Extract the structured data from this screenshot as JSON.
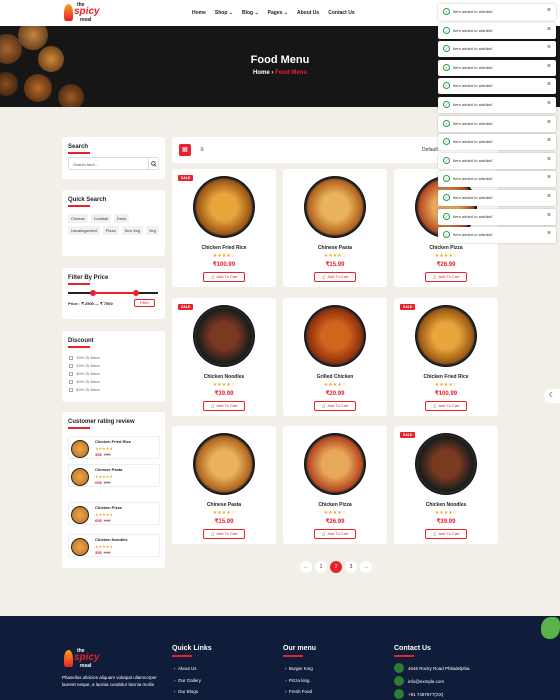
{
  "header": {
    "logo": {
      "top": "the",
      "main": "spicy",
      "bottom": "meal"
    },
    "nav": [
      "Home",
      "Shop ⌄",
      "Blog ⌄",
      "Pages ⌄",
      "About Us",
      "Contact Us"
    ]
  },
  "hero": {
    "title": "Food Menu",
    "crumb_home": "Home",
    "crumb_sep": "›",
    "crumb_current": "Food Menu"
  },
  "sidebar": {
    "search": {
      "title": "Search",
      "placeholder": "Search here..."
    },
    "quick": {
      "title": "Quick Search",
      "tags": [
        "Cheese",
        "Cocktail",
        "Drink",
        "Uncategorized",
        "Pizza",
        "Non Veg",
        "Veg"
      ]
    },
    "price": {
      "title": "Filter By Price",
      "label": "Price : ₹ 2500 — ₹ 7500",
      "button": "Filter",
      "range_low_fraction": 0.25,
      "range_high_fraction": 0.75
    },
    "discount": {
      "title": "Discount",
      "options": [
        "10% Or More",
        "20% Or More",
        "30% Or More",
        "40% Or More",
        "50% Or More"
      ]
    },
    "reviews": {
      "title": "Customer rating review",
      "items": [
        {
          "name": "Chicken Fried Rice",
          "stars": "★★★★★",
          "price": "35$",
          "old": "23$"
        },
        {
          "name": "Chinese Pasta",
          "stars": "★★★★★",
          "price": "65$",
          "old": "25$"
        },
        {
          "name": "Chicken Pizza",
          "stars": "★★★★★",
          "price": "65$",
          "old": "25$"
        },
        {
          "name": "Chicken Noodles",
          "stars": "★★★★★",
          "price": "35$",
          "old": "23$"
        }
      ]
    }
  },
  "toolbar": {
    "grid_icon": "▦",
    "list_icon": "≡",
    "sort_label": "Default"
  },
  "products": [
    {
      "name": "Chicken Fried Rice",
      "price": "₹100.99",
      "sale": "SALE",
      "stars": "★★★★☆",
      "cart": "Add To Cart",
      "color1": "#e7a53c",
      "color2": "#9a5512"
    },
    {
      "name": "Chinese Pasta",
      "price": "₹15.99",
      "sale": "",
      "stars": "★★★★☆",
      "cart": "Add To Cart",
      "color1": "#eab45c",
      "color2": "#b0601d"
    },
    {
      "name": "Chicken Pizza",
      "price": "₹26.99",
      "sale": "",
      "stars": "★★★★☆",
      "cart": "Add To Cart",
      "color1": "#e8a85a",
      "color2": "#b3461f"
    },
    {
      "name": "Chicken Noodles",
      "price": "₹39.99",
      "sale": "SALE",
      "stars": "★★★★☆",
      "cart": "Add To Cart",
      "color1": "#7a3a22",
      "color2": "#1c1c1c"
    },
    {
      "name": "Grilled Chicken",
      "price": "₹20.99",
      "sale": "",
      "stars": "★★★★☆",
      "cart": "Add To Cart",
      "color1": "#d2651e",
      "color2": "#8a2f0c"
    },
    {
      "name": "Chicken Fried Rice",
      "price": "₹100.99",
      "sale": "SALE",
      "stars": "★★★★☆",
      "cart": "Add To Cart",
      "color1": "#e7a53c",
      "color2": "#9a5512"
    },
    {
      "name": "Chinese Pasta",
      "price": "₹15.99",
      "sale": "",
      "stars": "★★★★☆",
      "cart": "Add To Cart",
      "color1": "#eab45c",
      "color2": "#b0601d"
    },
    {
      "name": "Chicken Pizza",
      "price": "₹26.99",
      "sale": "",
      "stars": "★★★★☆",
      "cart": "Add To Cart",
      "color1": "#e8a85a",
      "color2": "#b3461f"
    },
    {
      "name": "Chicken Noodles",
      "price": "₹39.99",
      "sale": "SALE",
      "stars": "★★★★☆",
      "cart": "Add To Cart",
      "color1": "#7a3a22",
      "color2": "#1c1c1c"
    }
  ],
  "pagination": [
    "←",
    "1",
    "2",
    "3",
    "→"
  ],
  "toasts": [
    "Item added to wishlist!",
    "Item added to wishlist!",
    "Item added to wishlist!",
    "Item added to wishlist!",
    "Item added to wishlist!",
    "Item added to wishlist!",
    "Item added to wishlist!",
    "Item added to wishlist!",
    "Item added to wishlist!",
    "Item added to wishlist!",
    "Item added to wishlist!",
    "Item added to wishlist!",
    "Item added to wishlist!"
  ],
  "footer": {
    "about": "Phasellus ultricies aliquam volutpat ullamcorper laoreet neque, a lacinia curabitur lacinia mollis",
    "quick_title": "Quick Links",
    "quick": [
      "About Us",
      "Our Gallery",
      "Our Blogs"
    ],
    "menu_title": "Our menu",
    "menu": [
      "Burger King",
      "Pizza king",
      "Fresh Food"
    ],
    "contact_title": "Contact Us",
    "contact": [
      "4648 Rocky Road Philadelphia",
      "info@exmple.com",
      "+91 7487977(XX)"
    ]
  },
  "colors": {
    "accent": "#e8212b",
    "footer": "#0f1c3a",
    "star": "#f5a623"
  }
}
